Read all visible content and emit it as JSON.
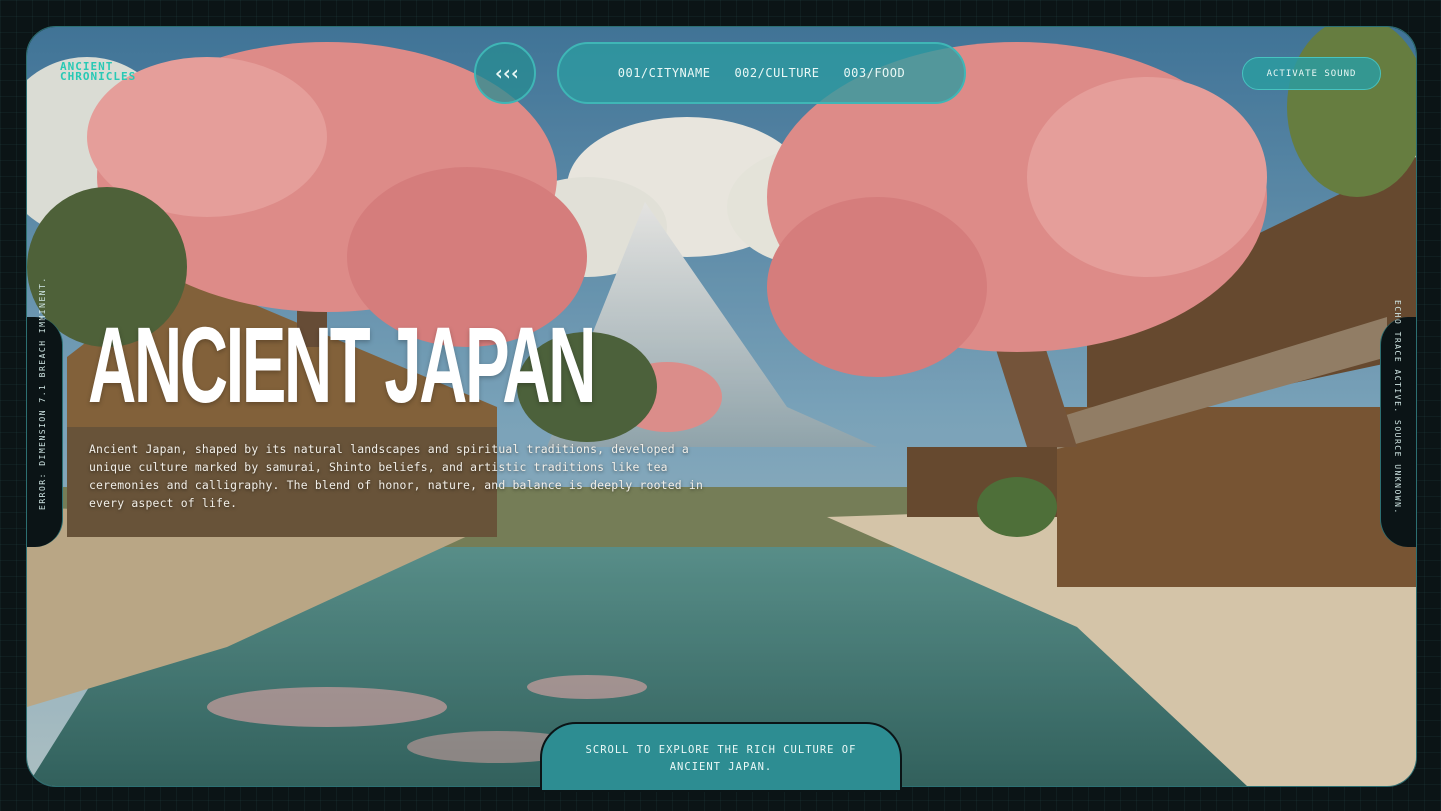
{
  "brand": {
    "logo_line1": "ancient",
    "logo_line2": "chronicles"
  },
  "nav": {
    "back_icon": "chevrons-left-icon",
    "items": [
      {
        "label": "001/CITYNAME"
      },
      {
        "label": "002/CULTURE"
      },
      {
        "label": "003/FOOD"
      }
    ],
    "sound_label": "ACTIVATE SOUND"
  },
  "hero": {
    "title": "ANCIENT JAPAN",
    "description": "Ancient Japan, shaped by its natural landscapes and spiritual traditions, developed a unique culture marked by samurai, Shinto beliefs, and artistic traditions like tea ceremonies and calligraphy. The blend of honor, nature, and balance is deeply rooted in every aspect of life."
  },
  "side": {
    "left_text": "ERROR: DIMENSION 7.1 BREACH IMMINENT.",
    "right_text": "ECHO TRACE ACTIVE. SOURCE UNKNOWN."
  },
  "footer": {
    "scroll_text": "SCROLL TO EXPLORE THE RICH CULTURE OF ANCIENT JAPAN."
  },
  "colors": {
    "accent": "#2d9aa0",
    "accent_border": "#3fb6b6",
    "background": "#0b1416",
    "logo": "#28c9b5"
  }
}
